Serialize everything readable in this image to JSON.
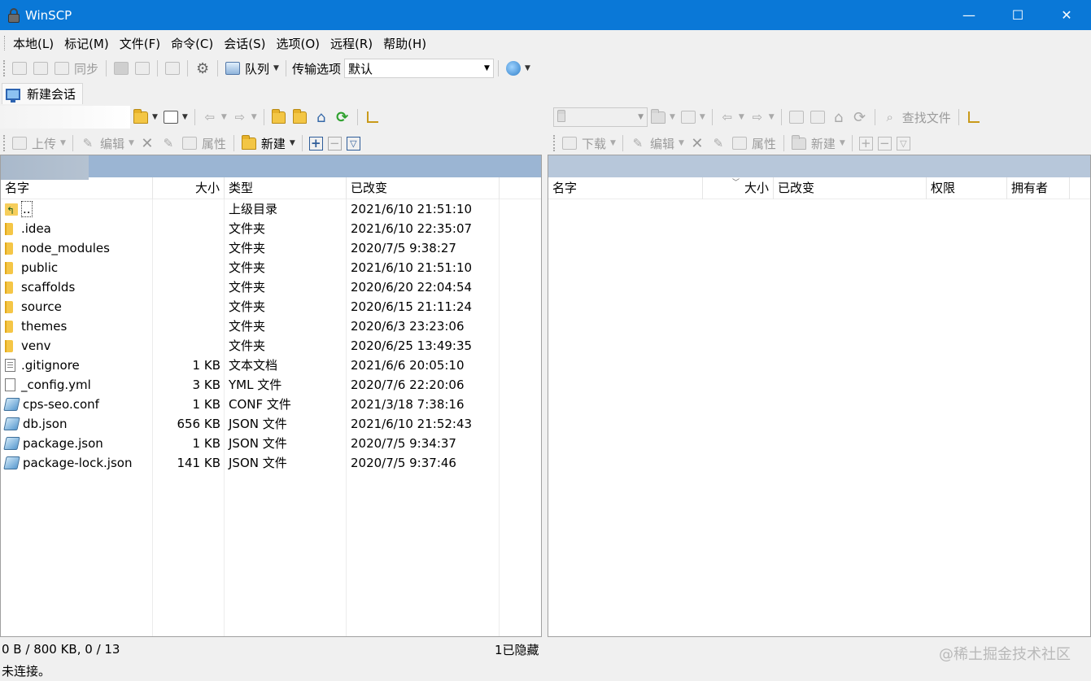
{
  "window": {
    "title": "WinSCP",
    "minimize": "—",
    "maximize": "☐",
    "close": "✕"
  },
  "menu": [
    "本地(L)",
    "标记(M)",
    "文件(F)",
    "命令(C)",
    "会话(S)",
    "选项(O)",
    "远程(R)",
    "帮助(H)"
  ],
  "toolbar": {
    "sync_label": "同步",
    "queue_label": "队列",
    "transfer_options_label": "传输选项",
    "transfer_preset": "默认"
  },
  "session_tab": {
    "label": "新建会话"
  },
  "local": {
    "upload_label": "上传",
    "edit_label": "编辑",
    "properties_label": "属性",
    "new_label": "新建",
    "columns": {
      "name": "名字",
      "size": "大小",
      "type": "类型",
      "changed": "已改变"
    },
    "files": [
      {
        "name": "..",
        "size": "",
        "type": "上级目录",
        "changed": "2021/6/10  21:51:10",
        "icon": "parent-dir"
      },
      {
        "name": ".idea",
        "size": "",
        "type": "文件夹",
        "changed": "2021/6/10  22:35:07",
        "icon": "folder"
      },
      {
        "name": "node_modules",
        "size": "",
        "type": "文件夹",
        "changed": "2020/7/5  9:38:27",
        "icon": "folder"
      },
      {
        "name": "public",
        "size": "",
        "type": "文件夹",
        "changed": "2021/6/10  21:51:10",
        "icon": "folder"
      },
      {
        "name": "scaffolds",
        "size": "",
        "type": "文件夹",
        "changed": "2020/6/20  22:04:54",
        "icon": "folder"
      },
      {
        "name": "source",
        "size": "",
        "type": "文件夹",
        "changed": "2020/6/15  21:11:24",
        "icon": "folder"
      },
      {
        "name": "themes",
        "size": "",
        "type": "文件夹",
        "changed": "2020/6/3  23:23:06",
        "icon": "folder"
      },
      {
        "name": "venv",
        "size": "",
        "type": "文件夹",
        "changed": "2020/6/25  13:49:35",
        "icon": "folder"
      },
      {
        "name": ".gitignore",
        "size": "1 KB",
        "type": "文本文档",
        "changed": "2021/6/6  20:05:10",
        "icon": "text"
      },
      {
        "name": "_config.yml",
        "size": "3 KB",
        "type": "YML 文件",
        "changed": "2020/7/6  22:20:06",
        "icon": "blank"
      },
      {
        "name": "cps-seo.conf",
        "size": "1 KB",
        "type": "CONF 文件",
        "changed": "2021/3/18  7:38:16",
        "icon": "config"
      },
      {
        "name": "db.json",
        "size": "656 KB",
        "type": "JSON 文件",
        "changed": "2021/6/10  21:52:43",
        "icon": "config"
      },
      {
        "name": "package.json",
        "size": "1 KB",
        "type": "JSON 文件",
        "changed": "2020/7/5  9:34:37",
        "icon": "config"
      },
      {
        "name": "package-lock.json",
        "size": "141 KB",
        "type": "JSON 文件",
        "changed": "2020/7/5  9:37:46",
        "icon": "config"
      }
    ],
    "status_selection": "0 B / 800 KB,   0 / 13",
    "status_hidden": "1已隐藏"
  },
  "remote": {
    "find_files_label": "查找文件",
    "download_label": "下载",
    "edit_label": "编辑",
    "properties_label": "属性",
    "new_label": "新建",
    "columns": {
      "name": "名字",
      "size": "大小",
      "changed": "已改变",
      "rights": "权限",
      "owner": "拥有者"
    }
  },
  "status_connection": "未连接。",
  "watermark": "@稀土掘金技术社区"
}
